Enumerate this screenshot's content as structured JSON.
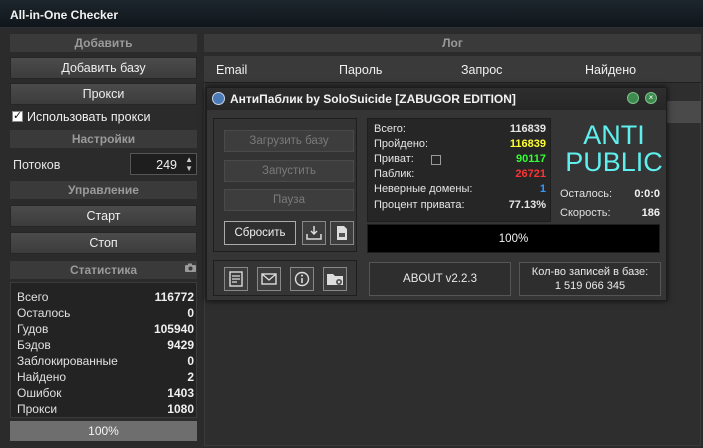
{
  "window": {
    "title": "All-in-One Checker"
  },
  "left": {
    "add_section": "Добавить",
    "add_base": "Добавить базу",
    "proxy_button": "Прокси",
    "use_proxy_label": "Использовать прокси",
    "use_proxy_checked": true,
    "settings_section": "Настройки",
    "threads_label": "Потоков",
    "threads_value": "249",
    "control_section": "Управление",
    "start_button": "Старт",
    "stop_button": "Стоп",
    "stats_section": "Статистика",
    "stats": [
      {
        "label": "Всего",
        "value": "116772"
      },
      {
        "label": "Осталось",
        "value": "0"
      },
      {
        "label": "Гудов",
        "value": "105940"
      },
      {
        "label": "Бэдов",
        "value": "9429"
      },
      {
        "label": "Заблокированные",
        "value": "0"
      },
      {
        "label": "Найдено",
        "value": "2"
      },
      {
        "label": "Ошибок",
        "value": "1403"
      },
      {
        "label": "Прокси",
        "value": "1080"
      }
    ],
    "progress_text": "100%",
    "progress": 1.0
  },
  "log": {
    "title": "Лог",
    "columns": [
      "Email",
      "Пароль",
      "Запрос",
      "Найдено"
    ]
  },
  "antipublic": {
    "title": "АнтиПаблик by SoloSuicide [ZABUGOR EDITION]",
    "buttons": {
      "load_base": "Загрузить базу",
      "run": "Запустить",
      "pause": "Пауза",
      "reset": "Сбросить"
    },
    "stats": [
      {
        "label": "Всего:",
        "value": "116839",
        "color": "#e6e6e6"
      },
      {
        "label": "Пройдено:",
        "value": "116839",
        "color": "#ffff33"
      },
      {
        "label": "Приват:",
        "value": "90117",
        "color": "#33ff33"
      },
      {
        "label": "Паблик:",
        "value": "26721",
        "color": "#ff3333"
      },
      {
        "label": "Неверные домены:",
        "value": "1",
        "color": "#3399ff"
      },
      {
        "label": "Процент привата:",
        "value": "77.13%",
        "color": "#e6e6e6"
      }
    ],
    "brand_line1": "ANTI",
    "brand_line2": "PUBLIC",
    "brand_color": "#5ef0ee",
    "remaining_label": "Осталось:",
    "remaining_value": "0:0:0",
    "speed_label": "Скорость:",
    "speed_value": "186",
    "progress_text": "100%",
    "about_button": "ABOUT v2.2.3",
    "db_label": "Кол-во записей в базе:",
    "db_count": "1 519 066 345",
    "tool_icons": [
      "report-icon",
      "mail-icon",
      "info-icon",
      "folder-settings-icon"
    ]
  }
}
